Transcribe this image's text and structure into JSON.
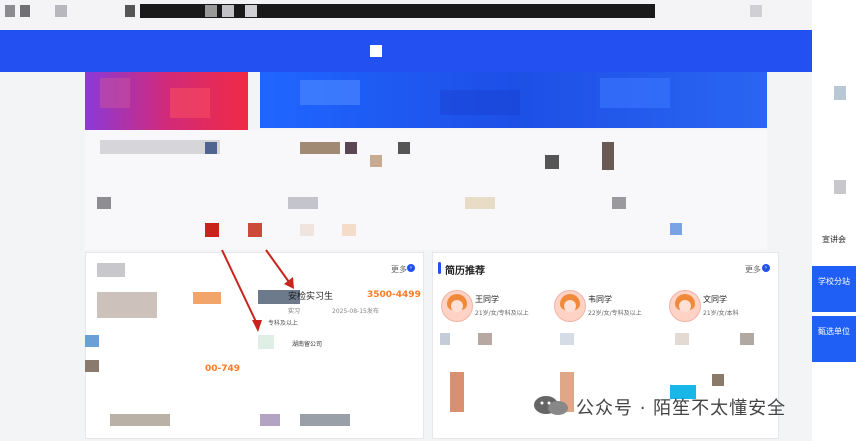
{
  "colors": {
    "brand_blue": "#2350f0",
    "salary_orange": "#ff7a22",
    "annotation_red": "#c8241c"
  },
  "top_band": {
    "logo_icon": "logo-square-icon"
  },
  "jobs": {
    "title_partial": "安检实习生",
    "salary": "3500-4499",
    "type": "实习",
    "date": "2025-08-15发布",
    "education": "专科及以上",
    "partial_company_fragment": "湖南留公司",
    "second_salary_partial": "00-749"
  },
  "jobs_more": "更多",
  "resume": {
    "section_title": "简历推荐",
    "more_label": "更多",
    "candidates": [
      {
        "name": "王同学",
        "meta": "21岁/女/专科及以上"
      },
      {
        "name": "韦同学",
        "meta": "22岁/女/专科及以上"
      },
      {
        "name": "文同学",
        "meta": "21岁/女/本科"
      }
    ]
  },
  "side_nav": {
    "item_text": "宣讲会",
    "school_branch": "学校分站",
    "recruiting_unit": "甄选单位"
  },
  "watermark": {
    "text": "公众号 · 陌笙不太懂安全"
  }
}
